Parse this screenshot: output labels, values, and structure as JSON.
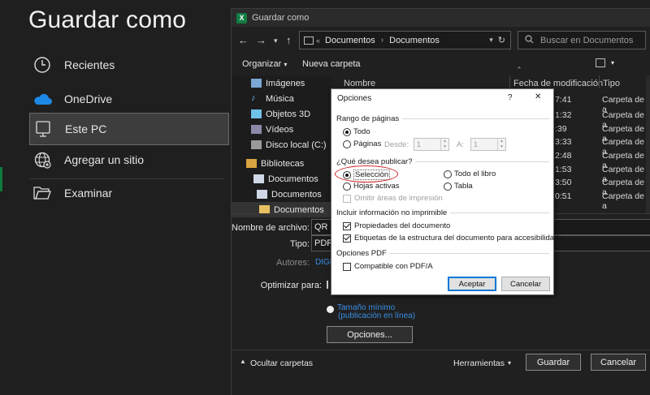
{
  "backstage": {
    "title": "Guardar como",
    "items": [
      {
        "label": "Recientes",
        "icon": "clock-icon"
      },
      {
        "label": "OneDrive",
        "icon": "cloud-icon"
      },
      {
        "label": "Este PC",
        "icon": "pc-icon"
      },
      {
        "label": "Agregar un sitio",
        "icon": "globe-icon"
      },
      {
        "label": "Examinar",
        "icon": "folder-open-icon"
      }
    ]
  },
  "save_dialog": {
    "title": "Guardar como",
    "path": [
      "Documentos",
      "Documentos"
    ],
    "search_placeholder": "Buscar en Documentos",
    "toolbar": {
      "organize": "Organizar",
      "new_folder": "Nueva carpeta"
    },
    "nav": [
      {
        "label": "Imágenes",
        "icon": "pictures-icon"
      },
      {
        "label": "Música",
        "icon": "music-icon"
      },
      {
        "label": "Objetos 3D",
        "icon": "objects3d-icon"
      },
      {
        "label": "Vídeos",
        "icon": "videos-icon"
      },
      {
        "label": "Disco local (C:)",
        "icon": "drive-icon"
      },
      {
        "label": "Bibliotecas",
        "icon": "libraries-icon"
      },
      {
        "label": "Documentos",
        "icon": "documents-icon"
      },
      {
        "label": "Documentos",
        "icon": "documents-icon"
      },
      {
        "label": "Documentos",
        "icon": "folder-icon"
      }
    ],
    "columns": {
      "name": "Nombre",
      "date": "Fecha de modificación",
      "type": "Tipo"
    },
    "rows": [
      {
        "time": "7:41",
        "type": "Carpeta de a"
      },
      {
        "time": "1:32",
        "type": "Carpeta de a"
      },
      {
        "time": ":39",
        "type": "Carpeta de a"
      },
      {
        "time": "3:33",
        "type": "Carpeta de a"
      },
      {
        "time": "2:48",
        "type": "Carpeta de a"
      },
      {
        "time": "1:53",
        "type": "Carpeta de a"
      },
      {
        "time": "3:50",
        "type": "Carpeta de a"
      },
      {
        "time": "0:51",
        "type": "Carpeta de a"
      }
    ],
    "form": {
      "filename_label": "Nombre de archivo:",
      "filename_value": "QR E",
      "type_label": "Tipo:",
      "type_value": "PDF",
      "authors_label": "Autores:",
      "authors_value": "DIGE",
      "optimize_label": "Optimizar para:",
      "optimize_min": "Tamaño mínimo",
      "optimize_min_sub": "(publicación en línea)",
      "options_button": "Opciones..."
    },
    "footer": {
      "hide_folders": "Ocultar carpetas",
      "tools": "Herramientas",
      "save": "Guardar",
      "cancel": "Cancelar"
    }
  },
  "options_dialog": {
    "title": "Opciones",
    "help": "?",
    "close": "✕",
    "page_range": {
      "heading": "Rango de páginas",
      "all": "Todo",
      "pages": "Páginas",
      "from_label": "Desde:",
      "from_value": "1",
      "to_label": "A:",
      "to_value": "1"
    },
    "publish": {
      "heading": "¿Qué desea publicar?",
      "selection": "Selección",
      "whole_book": "Todo el libro",
      "active_sheets": "Hojas activas",
      "table": "Tabla",
      "ignore_print_areas": "Omitir áreas de impresión"
    },
    "non_print": {
      "heading": "Incluir información no imprimible",
      "doc_props": "Propiedades del documento",
      "structure_tags": "Etiquetas de la estructura del documento para accesibilidad"
    },
    "pdf": {
      "heading": "Opciones PDF",
      "compatible": "Compatible con PDF/A"
    },
    "accept": "Aceptar",
    "cancel": "Cancelar"
  }
}
